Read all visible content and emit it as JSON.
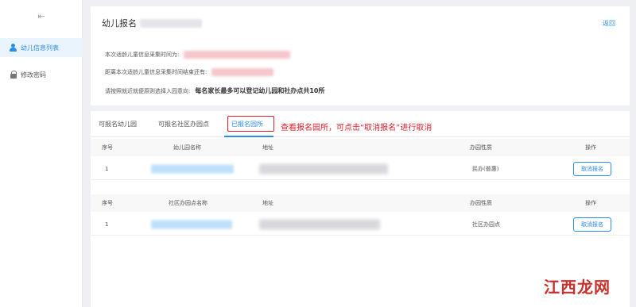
{
  "sidebar": {
    "items": [
      {
        "label": "幼儿信息列表",
        "icon": "users-icon",
        "active": true
      },
      {
        "label": "修改密码",
        "icon": "lock-icon",
        "active": false
      }
    ]
  },
  "header": {
    "title": "幼儿报名",
    "back_label": "返回",
    "info_line1": "本次适龄儿童信息采集时间为:",
    "info_line2": "距离本次适龄儿童信息采集时间结束还有:",
    "info_line3": "请按照就近就便原则选择入园意向:",
    "notice": "每名家长最多可以登记幼儿园和社办点共10所"
  },
  "tabs": [
    {
      "label": "可报名幼儿园"
    },
    {
      "label": "可报名社区办园点"
    },
    {
      "label": "已报名园所",
      "active": true
    }
  ],
  "annotation": "查看报名园所，可点击“取消报名”进行取消",
  "kindergarten_table": {
    "headers": [
      "序号",
      "幼儿园名称",
      "地址",
      "办园性质",
      "操作"
    ],
    "rows": [
      {
        "index": "1",
        "nature": "民办(普惠)",
        "action": "取消报名"
      }
    ]
  },
  "community_table": {
    "headers": [
      "序号",
      "社区办园点名称",
      "地址",
      "办园性质",
      "操作"
    ],
    "rows": [
      {
        "index": "1",
        "nature": "社区办园点",
        "action": "取消报名"
      }
    ]
  },
  "watermark": "江西龙网",
  "colors": {
    "accent": "#2d8cf0",
    "annotation": "#e0202a"
  }
}
